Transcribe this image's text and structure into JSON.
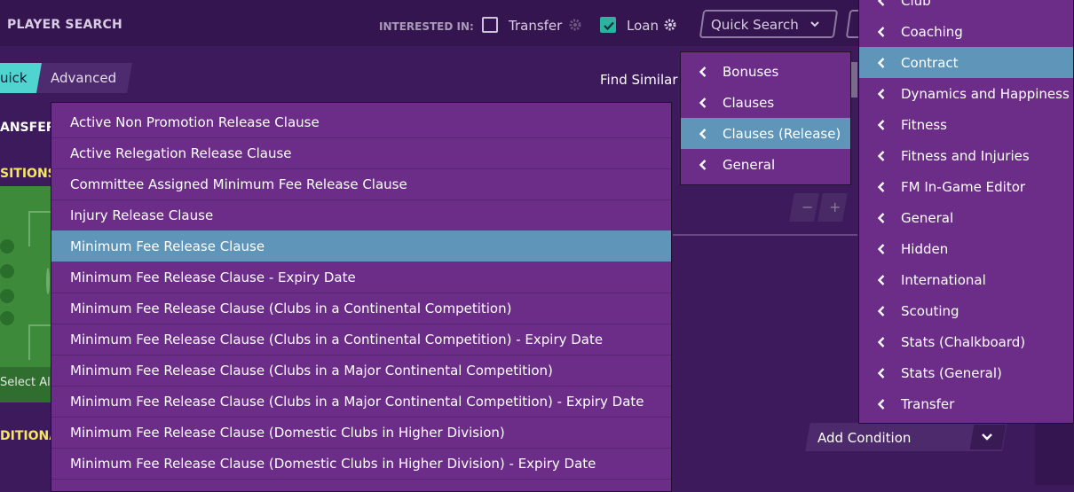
{
  "header": {
    "title": "PLAYER SEARCH",
    "interested_in": "INTERESTED IN:",
    "transfer_label": "Transfer",
    "transfer_checked": false,
    "loan_label": "Loan",
    "loan_checked": true,
    "quick_search": "Quick Search"
  },
  "tabs": {
    "quick": "uick",
    "advanced": "Advanced"
  },
  "find_similar": "Find Similar",
  "sections": {
    "transfer": "ANSFER",
    "positions": "SITIONS",
    "additional": "DITIONA"
  },
  "select_all": "Select All",
  "pm": {
    "minus": "−",
    "plus": "+"
  },
  "add_condition": "Add Condition",
  "colors": {
    "accent": "#4fd4d0",
    "selected": "#5f95b8",
    "menu_bg": "#6b2d88",
    "section_yellow": "#f5e663"
  },
  "main_list": {
    "selected_index": 4,
    "items": [
      "Active Non Promotion Release Clause",
      "Active Relegation Release Clause",
      "Committee Assigned Minimum Fee Release Clause",
      "Injury Release Clause",
      "Minimum Fee Release Clause",
      "Minimum Fee Release Clause - Expiry Date",
      "Minimum Fee Release Clause (Clubs in a Continental Competition)",
      "Minimum Fee Release Clause (Clubs in a Continental Competition) - Expiry Date",
      "Minimum Fee Release Clause (Clubs in a Major Continental Competition)",
      "Minimum Fee Release Clause (Clubs in a Major Continental Competition) - Expiry Date",
      "Minimum Fee Release Clause (Domestic Clubs in Higher Division)",
      "Minimum Fee Release Clause (Domestic Clubs in Higher Division) - Expiry Date"
    ]
  },
  "sub_menu": {
    "selected_index": 2,
    "items": [
      "Bonuses",
      "Clauses",
      "Clauses (Release)",
      "General"
    ]
  },
  "side_menu": {
    "selected_index": 2,
    "items": [
      "Club",
      "Coaching",
      "Contract",
      "Dynamics and Happiness",
      "Fitness",
      "Fitness and Injuries",
      "FM In-Game Editor",
      "General",
      "Hidden",
      "International",
      "Scouting",
      "Stats (Chalkboard)",
      "Stats (General)",
      "Transfer"
    ]
  }
}
